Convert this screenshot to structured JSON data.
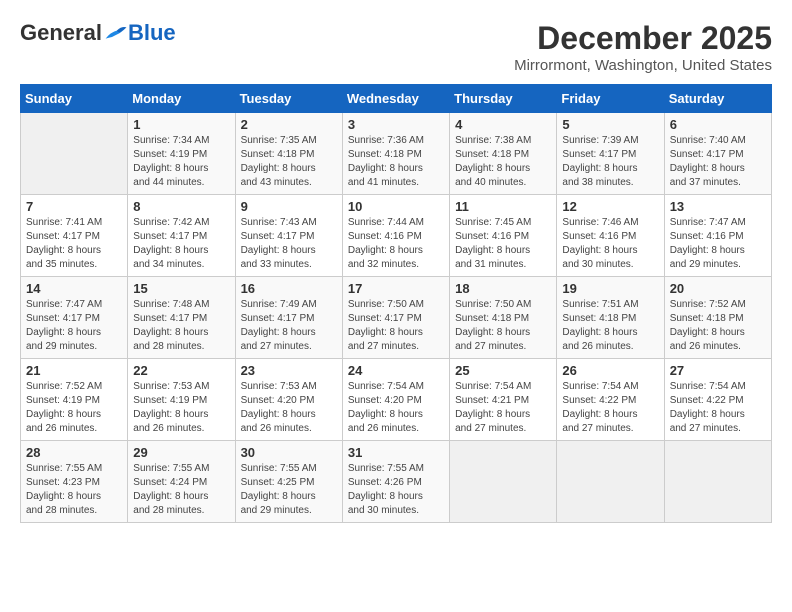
{
  "logo": {
    "general": "General",
    "blue": "Blue"
  },
  "title": "December 2025",
  "location": "Mirrormont, Washington, United States",
  "headers": [
    "Sunday",
    "Monday",
    "Tuesday",
    "Wednesday",
    "Thursday",
    "Friday",
    "Saturday"
  ],
  "weeks": [
    [
      {
        "day": "",
        "info": ""
      },
      {
        "day": "1",
        "info": "Sunrise: 7:34 AM\nSunset: 4:19 PM\nDaylight: 8 hours\nand 44 minutes."
      },
      {
        "day": "2",
        "info": "Sunrise: 7:35 AM\nSunset: 4:18 PM\nDaylight: 8 hours\nand 43 minutes."
      },
      {
        "day": "3",
        "info": "Sunrise: 7:36 AM\nSunset: 4:18 PM\nDaylight: 8 hours\nand 41 minutes."
      },
      {
        "day": "4",
        "info": "Sunrise: 7:38 AM\nSunset: 4:18 PM\nDaylight: 8 hours\nand 40 minutes."
      },
      {
        "day": "5",
        "info": "Sunrise: 7:39 AM\nSunset: 4:17 PM\nDaylight: 8 hours\nand 38 minutes."
      },
      {
        "day": "6",
        "info": "Sunrise: 7:40 AM\nSunset: 4:17 PM\nDaylight: 8 hours\nand 37 minutes."
      }
    ],
    [
      {
        "day": "7",
        "info": "Sunrise: 7:41 AM\nSunset: 4:17 PM\nDaylight: 8 hours\nand 35 minutes."
      },
      {
        "day": "8",
        "info": "Sunrise: 7:42 AM\nSunset: 4:17 PM\nDaylight: 8 hours\nand 34 minutes."
      },
      {
        "day": "9",
        "info": "Sunrise: 7:43 AM\nSunset: 4:17 PM\nDaylight: 8 hours\nand 33 minutes."
      },
      {
        "day": "10",
        "info": "Sunrise: 7:44 AM\nSunset: 4:16 PM\nDaylight: 8 hours\nand 32 minutes."
      },
      {
        "day": "11",
        "info": "Sunrise: 7:45 AM\nSunset: 4:16 PM\nDaylight: 8 hours\nand 31 minutes."
      },
      {
        "day": "12",
        "info": "Sunrise: 7:46 AM\nSunset: 4:16 PM\nDaylight: 8 hours\nand 30 minutes."
      },
      {
        "day": "13",
        "info": "Sunrise: 7:47 AM\nSunset: 4:16 PM\nDaylight: 8 hours\nand 29 minutes."
      }
    ],
    [
      {
        "day": "14",
        "info": "Sunrise: 7:47 AM\nSunset: 4:17 PM\nDaylight: 8 hours\nand 29 minutes."
      },
      {
        "day": "15",
        "info": "Sunrise: 7:48 AM\nSunset: 4:17 PM\nDaylight: 8 hours\nand 28 minutes."
      },
      {
        "day": "16",
        "info": "Sunrise: 7:49 AM\nSunset: 4:17 PM\nDaylight: 8 hours\nand 27 minutes."
      },
      {
        "day": "17",
        "info": "Sunrise: 7:50 AM\nSunset: 4:17 PM\nDaylight: 8 hours\nand 27 minutes."
      },
      {
        "day": "18",
        "info": "Sunrise: 7:50 AM\nSunset: 4:18 PM\nDaylight: 8 hours\nand 27 minutes."
      },
      {
        "day": "19",
        "info": "Sunrise: 7:51 AM\nSunset: 4:18 PM\nDaylight: 8 hours\nand 26 minutes."
      },
      {
        "day": "20",
        "info": "Sunrise: 7:52 AM\nSunset: 4:18 PM\nDaylight: 8 hours\nand 26 minutes."
      }
    ],
    [
      {
        "day": "21",
        "info": "Sunrise: 7:52 AM\nSunset: 4:19 PM\nDaylight: 8 hours\nand 26 minutes."
      },
      {
        "day": "22",
        "info": "Sunrise: 7:53 AM\nSunset: 4:19 PM\nDaylight: 8 hours\nand 26 minutes."
      },
      {
        "day": "23",
        "info": "Sunrise: 7:53 AM\nSunset: 4:20 PM\nDaylight: 8 hours\nand 26 minutes."
      },
      {
        "day": "24",
        "info": "Sunrise: 7:54 AM\nSunset: 4:20 PM\nDaylight: 8 hours\nand 26 minutes."
      },
      {
        "day": "25",
        "info": "Sunrise: 7:54 AM\nSunset: 4:21 PM\nDaylight: 8 hours\nand 27 minutes."
      },
      {
        "day": "26",
        "info": "Sunrise: 7:54 AM\nSunset: 4:22 PM\nDaylight: 8 hours\nand 27 minutes."
      },
      {
        "day": "27",
        "info": "Sunrise: 7:54 AM\nSunset: 4:22 PM\nDaylight: 8 hours\nand 27 minutes."
      }
    ],
    [
      {
        "day": "28",
        "info": "Sunrise: 7:55 AM\nSunset: 4:23 PM\nDaylight: 8 hours\nand 28 minutes."
      },
      {
        "day": "29",
        "info": "Sunrise: 7:55 AM\nSunset: 4:24 PM\nDaylight: 8 hours\nand 28 minutes."
      },
      {
        "day": "30",
        "info": "Sunrise: 7:55 AM\nSunset: 4:25 PM\nDaylight: 8 hours\nand 29 minutes."
      },
      {
        "day": "31",
        "info": "Sunrise: 7:55 AM\nSunset: 4:26 PM\nDaylight: 8 hours\nand 30 minutes."
      },
      {
        "day": "",
        "info": ""
      },
      {
        "day": "",
        "info": ""
      },
      {
        "day": "",
        "info": ""
      }
    ]
  ]
}
